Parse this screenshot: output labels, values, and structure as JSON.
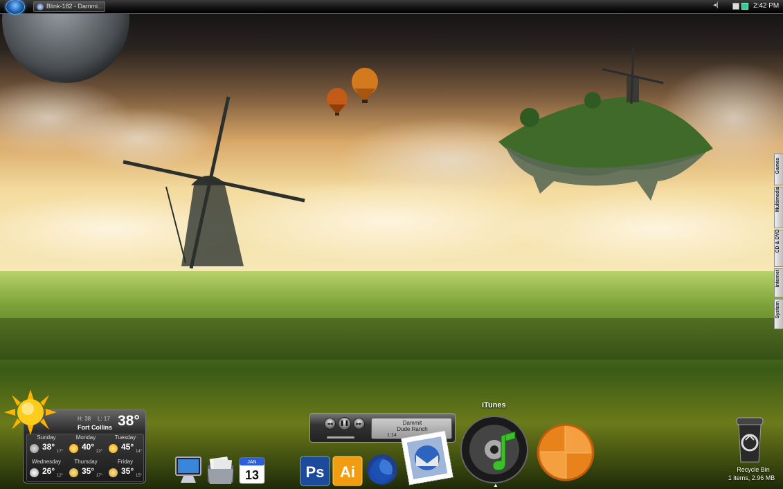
{
  "taskbar": {
    "window_button": "Blink-182 - Dammi...",
    "clock": "2:42 PM"
  },
  "side_tabs": [
    "Games",
    "Multimedia",
    "CD & DVD",
    "Internet",
    "System"
  ],
  "weather": {
    "high": "H: 38",
    "low": "L: 17",
    "city": "Fort Collins",
    "current": "38°",
    "forecast": [
      {
        "day": "Sunday",
        "temp": "38°",
        "low": "17°",
        "icon": "cloudy-icon"
      },
      {
        "day": "Monday",
        "temp": "40°",
        "low": "22°",
        "icon": "sunny-icon"
      },
      {
        "day": "Tuesday",
        "temp": "45°",
        "low": "14°",
        "icon": "sunny-icon"
      },
      {
        "day": "Wednesday",
        "temp": "26°",
        "low": "12°",
        "icon": "snow-icon"
      },
      {
        "day": "Thursday",
        "temp": "35°",
        "low": "17°",
        "icon": "partly-cloudy-icon"
      },
      {
        "day": "Friday",
        "temp": "35°",
        "low": "15°",
        "icon": "partly-cloudy-icon"
      }
    ]
  },
  "player": {
    "title": "Dammit",
    "artist": "Dude Ranch",
    "time": "1:14"
  },
  "dock": {
    "itunes_label": "iTunes",
    "icons": [
      "computer-icon",
      "mail-folder-icon",
      "calendar-icon",
      "photoshop-icon",
      "illustrator-icon",
      "firefox-icon",
      "thunderbird-icon",
      "itunes-icon",
      "vlc-icon"
    ],
    "calendar_month": "JAN",
    "calendar_day": "13",
    "ps_label": "Ps",
    "ai_label": "Ai"
  },
  "recycle_bin": {
    "label": "Recycle Bin",
    "info": "1 items, 2.96 MB"
  }
}
